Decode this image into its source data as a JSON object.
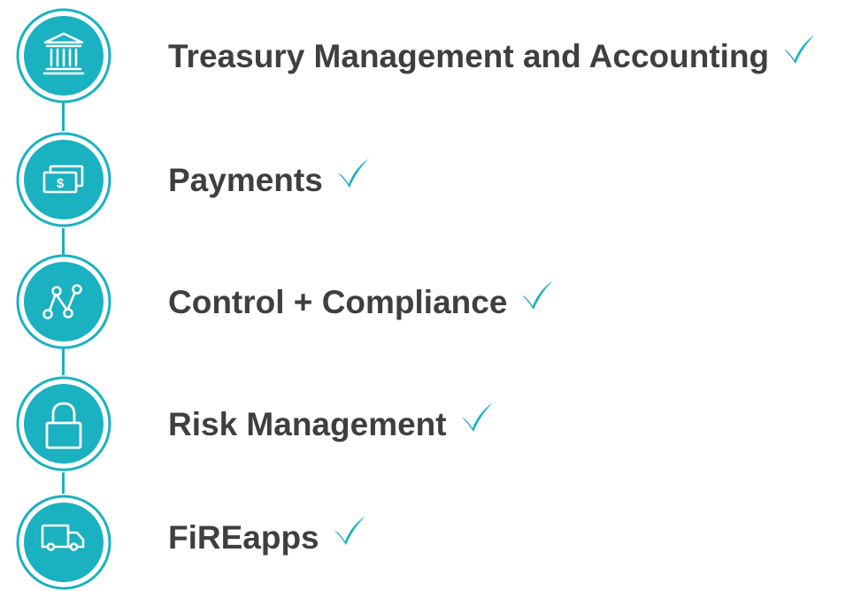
{
  "accent_color": "#1ab1c0",
  "text_color": "#3f3f3f",
  "items": [
    {
      "label": "Treasury Management and Accounting",
      "icon": "bank-icon"
    },
    {
      "label": "Payments",
      "icon": "money-icon"
    },
    {
      "label": "Control + Compliance",
      "icon": "network-icon"
    },
    {
      "label": "Risk Management",
      "icon": "lock-icon"
    },
    {
      "label": "FiREapps",
      "icon": "truck-icon"
    }
  ]
}
